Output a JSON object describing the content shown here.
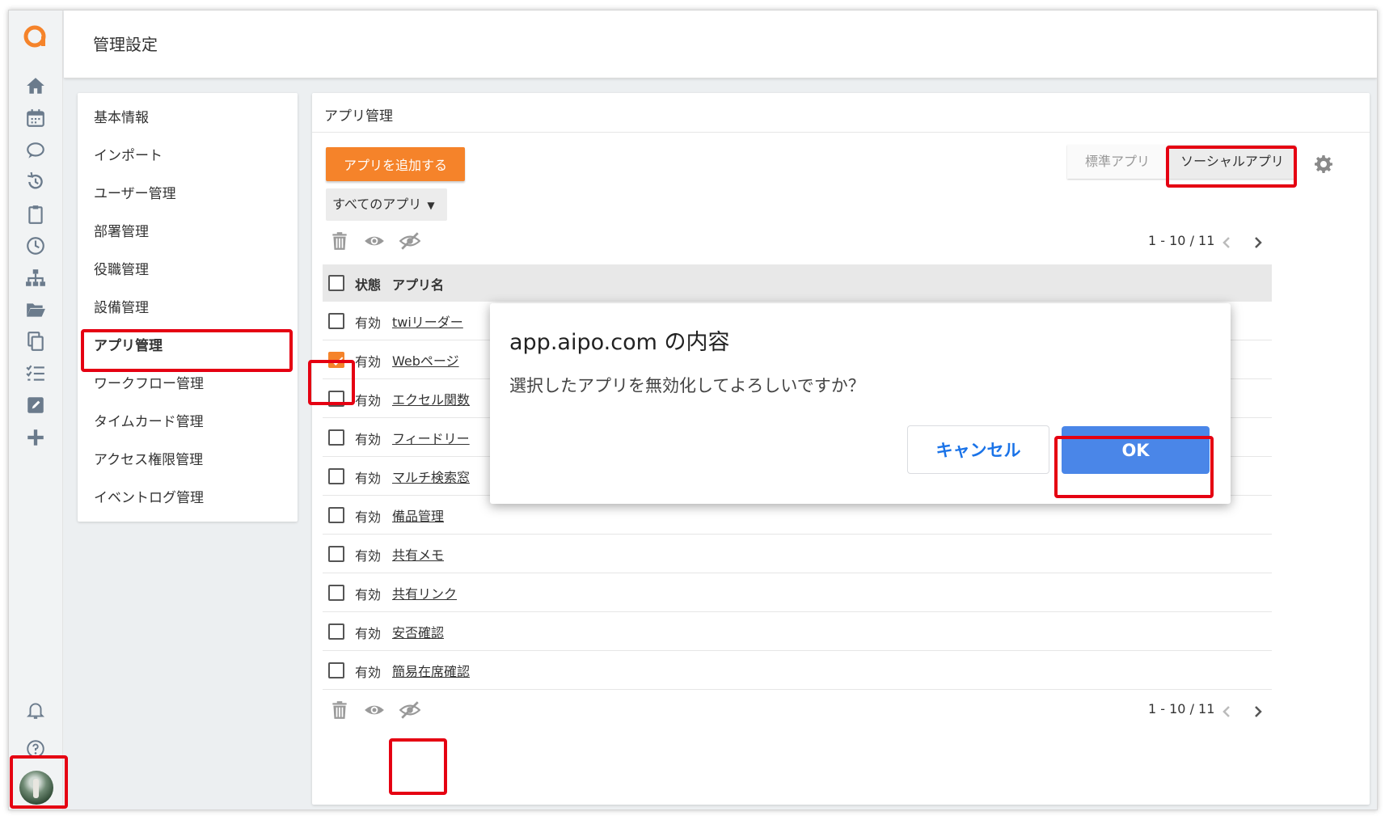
{
  "header": {
    "title": "管理設定"
  },
  "sidebar": {
    "items": [
      {
        "label": "基本情報"
      },
      {
        "label": "インポート"
      },
      {
        "label": "ユーザー管理"
      },
      {
        "label": "部署管理"
      },
      {
        "label": "役職管理"
      },
      {
        "label": "設備管理"
      },
      {
        "label": "アプリ管理",
        "active": true
      },
      {
        "label": "ワークフロー管理"
      },
      {
        "label": "タイムカード管理"
      },
      {
        "label": "アクセス権限管理"
      },
      {
        "label": "イベントログ管理"
      }
    ]
  },
  "main": {
    "title": "アプリ管理",
    "add_button": "アプリを追加する",
    "filter": {
      "selected": "すべてのアプリ"
    },
    "segments": {
      "standard": "標準アプリ",
      "social": "ソーシャルアプリ"
    },
    "pager": "1 - 10 / 11",
    "columns": {
      "status": "状態",
      "name": "アプリ名"
    },
    "rows": [
      {
        "status": "有効",
        "name": "twiリーダー",
        "checked": false
      },
      {
        "status": "有効",
        "name": "Webページ",
        "checked": true
      },
      {
        "status": "有効",
        "name": "エクセル関数",
        "checked": false
      },
      {
        "status": "有効",
        "name": "フィードリー",
        "checked": false
      },
      {
        "status": "有効",
        "name": "マルチ検索窓",
        "checked": false
      },
      {
        "status": "有効",
        "name": "備品管理",
        "checked": false
      },
      {
        "status": "有効",
        "name": "共有メモ",
        "checked": false
      },
      {
        "status": "有効",
        "name": "共有リンク",
        "checked": false
      },
      {
        "status": "有効",
        "name": "安否確認",
        "checked": false
      },
      {
        "status": "有効",
        "name": "簡易在席確認",
        "checked": false
      }
    ]
  },
  "dialog": {
    "title": "app.aipo.com の内容",
    "message": "選択したアプリを無効化してよろしいですか？",
    "cancel": "キャンセル",
    "ok": "OK"
  },
  "colors": {
    "accent": "#f5832a",
    "ok_button": "#4a86e8",
    "highlight": "#e50012"
  },
  "icons": [
    "home-icon",
    "calendar-icon",
    "chat-icon",
    "history-icon",
    "clipboard-icon",
    "clock-icon",
    "org-chart-icon",
    "folder-icon",
    "copy-icon",
    "checklist-icon",
    "edit-icon",
    "plus-icon",
    "bell-icon",
    "help-icon",
    "trash-icon",
    "eye-icon",
    "eye-off-icon",
    "gear-icon"
  ]
}
